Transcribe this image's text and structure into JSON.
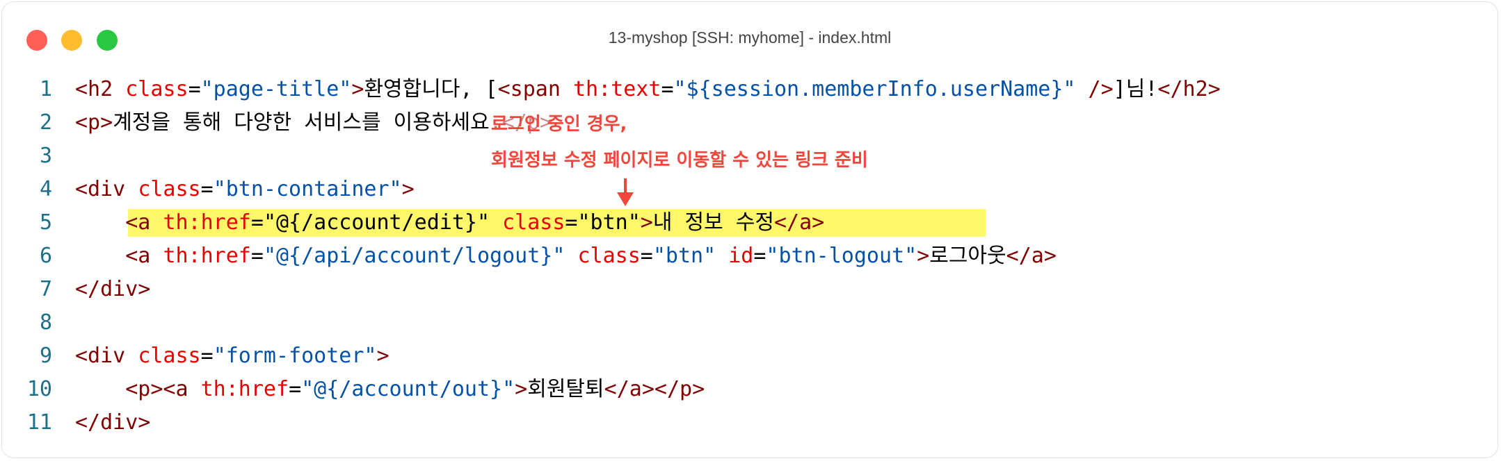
{
  "window": {
    "title": "13-myshop [SSH: myhome] - index.html"
  },
  "colors": {
    "tag": "#800000",
    "attr": "#e50000",
    "value": "#0451a5",
    "text": "#000000",
    "highlight": "#fff86a",
    "annotation": "#f0463c",
    "close": "#ff5f57",
    "minimize": "#febc2e",
    "maximize": "#28c840"
  },
  "annotation": {
    "line1": "로그인 중인 경우,",
    "line2": "회원정보 수정 페이지로 이동할 수 있는 링크 준비"
  },
  "editor": {
    "lines": [
      {
        "num": "1",
        "tokens": [
          {
            "t": "<h2",
            "c": "tag"
          },
          {
            "t": " ",
            "c": "text"
          },
          {
            "t": "class",
            "c": "attr"
          },
          {
            "t": "=",
            "c": "text"
          },
          {
            "t": "\"page-title\"",
            "c": "value"
          },
          {
            "t": ">",
            "c": "tag"
          },
          {
            "t": "환영합니다, [",
            "c": "text"
          },
          {
            "t": "<span",
            "c": "tag"
          },
          {
            "t": " ",
            "c": "text"
          },
          {
            "t": "th:text",
            "c": "attr"
          },
          {
            "t": "=",
            "c": "text"
          },
          {
            "t": "\"${session.memberInfo.userName}\"",
            "c": "value"
          },
          {
            "t": " />",
            "c": "tag"
          },
          {
            "t": "]님!",
            "c": "text"
          },
          {
            "t": "</h2>",
            "c": "tag"
          }
        ]
      },
      {
        "num": "2",
        "tokens": [
          {
            "t": "<p>",
            "c": "tag"
          },
          {
            "t": "계정을 통해 다양한 서비스를 이용하세요.",
            "c": "text"
          },
          {
            "t": "</p>",
            "c": "tag"
          }
        ]
      },
      {
        "num": "3",
        "tokens": []
      },
      {
        "num": "4",
        "tokens": [
          {
            "t": "<div",
            "c": "tag"
          },
          {
            "t": " ",
            "c": "text"
          },
          {
            "t": "class",
            "c": "attr"
          },
          {
            "t": "=",
            "c": "text"
          },
          {
            "t": "\"btn-container\"",
            "c": "value"
          },
          {
            "t": ">",
            "c": "tag"
          }
        ]
      },
      {
        "num": "5",
        "highlight": true,
        "tokens": [
          {
            "t": "    ",
            "c": "text"
          },
          {
            "t": "<a",
            "c": "tag"
          },
          {
            "t": " ",
            "c": "text"
          },
          {
            "t": "th:href",
            "c": "attr"
          },
          {
            "t": "=",
            "c": "text"
          },
          {
            "t": "\"@{/account/edit}\"",
            "c": "text"
          },
          {
            "t": " ",
            "c": "text"
          },
          {
            "t": "class",
            "c": "attr"
          },
          {
            "t": "=",
            "c": "text"
          },
          {
            "t": "\"btn\"",
            "c": "text"
          },
          {
            "t": ">",
            "c": "tag"
          },
          {
            "t": "내 정보 수정",
            "c": "text"
          },
          {
            "t": "</a>",
            "c": "tag"
          }
        ]
      },
      {
        "num": "6",
        "tokens": [
          {
            "t": "    ",
            "c": "text"
          },
          {
            "t": "<a",
            "c": "tag"
          },
          {
            "t": " ",
            "c": "text"
          },
          {
            "t": "th:href",
            "c": "attr"
          },
          {
            "t": "=",
            "c": "text"
          },
          {
            "t": "\"@{/api/account/logout}\"",
            "c": "value"
          },
          {
            "t": " ",
            "c": "text"
          },
          {
            "t": "class",
            "c": "attr"
          },
          {
            "t": "=",
            "c": "text"
          },
          {
            "t": "\"btn\"",
            "c": "value"
          },
          {
            "t": " ",
            "c": "text"
          },
          {
            "t": "id",
            "c": "attr"
          },
          {
            "t": "=",
            "c": "text"
          },
          {
            "t": "\"btn-logout\"",
            "c": "value"
          },
          {
            "t": ">",
            "c": "tag"
          },
          {
            "t": "로그아웃",
            "c": "text"
          },
          {
            "t": "</a>",
            "c": "tag"
          }
        ]
      },
      {
        "num": "7",
        "tokens": [
          {
            "t": "</div>",
            "c": "tag"
          }
        ]
      },
      {
        "num": "8",
        "tokens": []
      },
      {
        "num": "9",
        "tokens": [
          {
            "t": "<div",
            "c": "tag"
          },
          {
            "t": " ",
            "c": "text"
          },
          {
            "t": "class",
            "c": "attr"
          },
          {
            "t": "=",
            "c": "text"
          },
          {
            "t": "\"form-footer\"",
            "c": "value"
          },
          {
            "t": ">",
            "c": "tag"
          }
        ]
      },
      {
        "num": "10",
        "tokens": [
          {
            "t": "    ",
            "c": "text"
          },
          {
            "t": "<p><a",
            "c": "tag"
          },
          {
            "t": " ",
            "c": "text"
          },
          {
            "t": "th:href",
            "c": "attr"
          },
          {
            "t": "=",
            "c": "text"
          },
          {
            "t": "\"@{/account/out}\"",
            "c": "value"
          },
          {
            "t": ">",
            "c": "tag"
          },
          {
            "t": "회원탈퇴",
            "c": "text"
          },
          {
            "t": "</a></p>",
            "c": "tag"
          }
        ]
      },
      {
        "num": "11",
        "tokens": [
          {
            "t": "</div>",
            "c": "tag"
          }
        ]
      }
    ]
  }
}
